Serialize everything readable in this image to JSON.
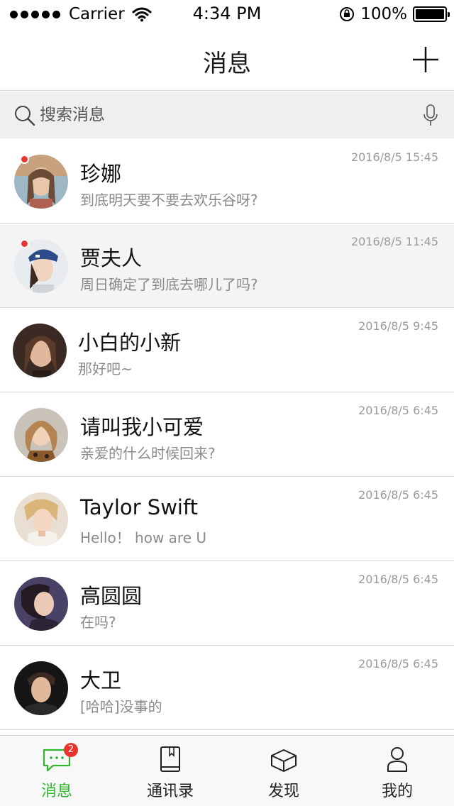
{
  "status_bar": {
    "carrier": "Carrier",
    "time": "4:34 PM",
    "battery": "100%"
  },
  "navbar": {
    "title": "消息",
    "add_icon": "plus-icon"
  },
  "search": {
    "placeholder": "搜索消息",
    "icons": [
      "search-icon",
      "microphone-icon"
    ]
  },
  "messages": [
    {
      "name": "珍娜",
      "preview": "到底明天要不要去欢乐谷呀?",
      "time": "2016/8/5 15:45",
      "unread": true
    },
    {
      "name": "贾夫人",
      "preview": "周日确定了到底去哪儿了吗?",
      "time": "2016/8/5 11:45",
      "unread": true,
      "selected": true
    },
    {
      "name": "小白的小新",
      "preview": "那好吧~",
      "time": "2016/8/5 9:45",
      "unread": false
    },
    {
      "name": "请叫我小可爱",
      "preview": "亲爱的什么时候回来?",
      "time": "2016/8/5 6:45",
      "unread": false
    },
    {
      "name": "Taylor Swift",
      "preview": "Hello！ how are U",
      "time": "2016/8/5 6:45",
      "unread": false
    },
    {
      "name": "高圆圆",
      "preview": "在吗?",
      "time": "2016/8/5 6:45",
      "unread": false
    },
    {
      "name": "大卫",
      "preview": "[哈哈]没事的",
      "time": "2016/8/5 6:45",
      "unread": false
    }
  ],
  "tabbar": {
    "tabs": [
      {
        "label": "消息",
        "icon": "chat-bubble-icon",
        "badge": "2",
        "active": true
      },
      {
        "label": "通讯录",
        "icon": "contacts-book-icon"
      },
      {
        "label": "发现",
        "icon": "discover-box-icon"
      },
      {
        "label": "我的",
        "icon": "profile-icon"
      }
    ]
  },
  "colors": {
    "accent_green": "#2fb52f",
    "unread_red": "#e8352f",
    "search_bg": "#efeff0",
    "selected_row": "#f4f4f4"
  }
}
